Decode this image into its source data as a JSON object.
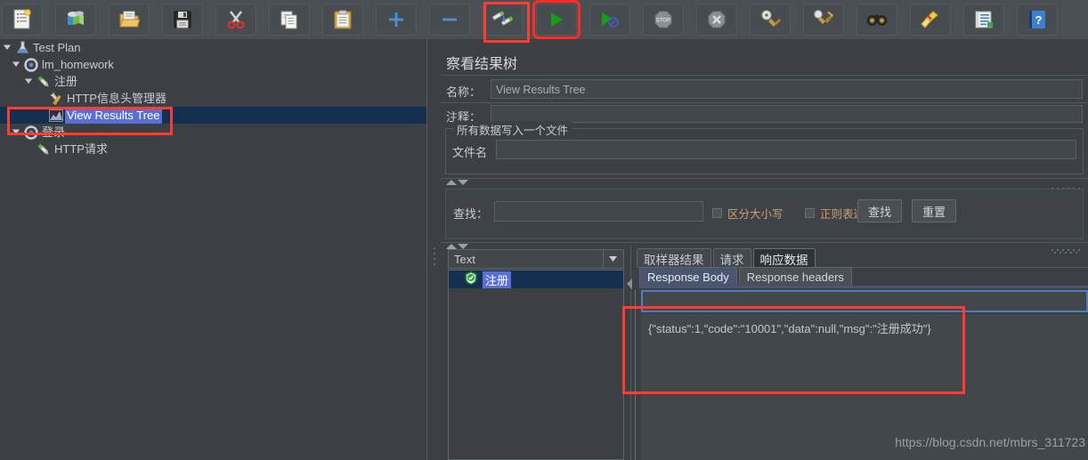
{
  "toolbar": {
    "buttons": [
      {
        "name": "new-icon",
        "label": "New"
      },
      {
        "name": "templates-icon",
        "label": "Templates"
      },
      {
        "name": "open-icon",
        "label": "Open"
      },
      {
        "name": "save-icon",
        "label": "Save"
      },
      {
        "name": "cut-icon",
        "label": "Cut"
      },
      {
        "name": "copy-icon",
        "label": "Copy"
      },
      {
        "name": "paste-icon",
        "label": "Paste"
      },
      {
        "name": "expand-all-icon",
        "label": "Expand"
      },
      {
        "name": "collapse-all-icon",
        "label": "Collapse"
      },
      {
        "name": "toggle-icon",
        "label": "Toggle"
      },
      {
        "name": "start-icon",
        "label": "Start"
      },
      {
        "name": "start-no-pauses-icon",
        "label": "Start no pauses"
      },
      {
        "name": "stop-icon",
        "label": "Stop"
      },
      {
        "name": "shutdown-icon",
        "label": "Shutdown"
      },
      {
        "name": "clear-icon",
        "label": "Clear"
      },
      {
        "name": "clear-all-icon",
        "label": "Clear All"
      },
      {
        "name": "search-icon",
        "label": "Search"
      },
      {
        "name": "reset-search-icon",
        "label": "Reset Search"
      },
      {
        "name": "function-helper-icon",
        "label": "Function Helper"
      },
      {
        "name": "help-icon",
        "label": "Help"
      }
    ],
    "highlight_color": "#ff2a24",
    "highlighted_button": "start-icon"
  },
  "tree": {
    "nodes": [
      {
        "label": "Test Plan",
        "icon": "test-plan-icon",
        "depth": 0,
        "expanded": true,
        "selected": false
      },
      {
        "label": "lm_homework",
        "icon": "thread-group-icon",
        "depth": 1,
        "expanded": true,
        "selected": false
      },
      {
        "label": "注册",
        "icon": "http-request-icon",
        "depth": 2,
        "expanded": true,
        "selected": false
      },
      {
        "label": "HTTP信息头管理器",
        "icon": "header-manager-icon",
        "depth": 3,
        "expanded": false,
        "selected": false
      },
      {
        "label": "View Results Tree",
        "icon": "view-results-tree-icon",
        "depth": 3,
        "expanded": false,
        "selected": true
      },
      {
        "label": "登录",
        "icon": "thread-group-icon",
        "depth": 2,
        "expanded": true,
        "selected": false
      },
      {
        "label": "HTTP请求",
        "icon": "http-request-icon",
        "depth": 3,
        "expanded": false,
        "selected": false
      }
    ]
  },
  "panel": {
    "title": "察看结果树",
    "name_label": "名称：",
    "name_value": "View Results Tree",
    "comment_label": "注释：",
    "comment_value": "",
    "file_group_title": "所有数据写入一个文件",
    "filename_label": "文件名",
    "filename_value": ""
  },
  "find": {
    "label": "查找：",
    "value": "",
    "case_sensitive_label": "区分大小写",
    "case_sensitive_checked": false,
    "regex_label": "正则表达式",
    "regex_checked": false,
    "find_button": "查找",
    "reset_button": "重置"
  },
  "results": {
    "renderer_selected": "Text",
    "entries": [
      {
        "label": "注册",
        "status": "success",
        "icon": "success-shield-icon"
      }
    ]
  },
  "tabs": {
    "main": [
      {
        "label": "取样器结果",
        "active": false
      },
      {
        "label": "请求",
        "active": false
      },
      {
        "label": "响应数据",
        "active": true
      }
    ],
    "sub": [
      {
        "label": "Response Body",
        "active": true
      },
      {
        "label": "Response headers",
        "active": false
      }
    ]
  },
  "response": {
    "search_field_value": "",
    "body": "{\"status\":1,\"code\":\"10001\",\"data\":null,\"msg\":\"注册成功\"}"
  },
  "watermark": {
    "text": "https://blog.csdn.net/mbrs_311723"
  },
  "annotations": {
    "color": "#ff3b30",
    "boxes": [
      "toolbar-start-button",
      "tree-selected-node",
      "response-body-content"
    ]
  }
}
